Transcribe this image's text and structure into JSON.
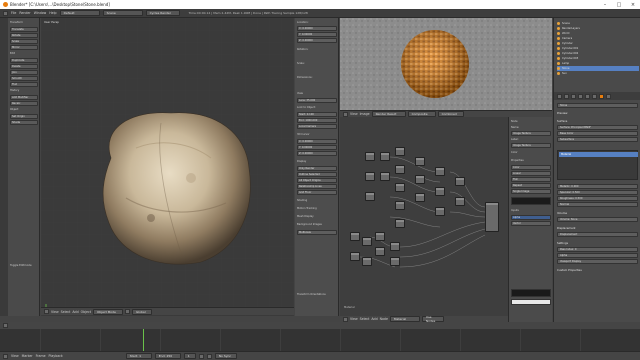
{
  "window": {
    "title": "Blender* [C:\\Users\\...\\Desktop\\Stone\\Stone.blend]",
    "controls": [
      "–",
      "□",
      "×"
    ]
  },
  "topbar": {
    "menus": [
      "File",
      "Render",
      "Window",
      "Help"
    ],
    "layout": "Default",
    "scene": "Scene",
    "engine": "Cycles Render",
    "stats": "Time:00:00.14 | Mem:1.42M, Peak 1.90M | Done | Path Tracing Sample 128/128"
  },
  "left_panel": {
    "sections": [
      "Transform",
      "Edit",
      "History",
      "Object"
    ],
    "buttons": [
      "Translate",
      "Rotate",
      "Scale",
      "Mirror",
      "Duplicate",
      "Delete",
      "Join",
      "Smooth",
      "Flat",
      "Add Modifier",
      "Recalc",
      "Set Origin",
      "Shade",
      "Remove",
      "Data",
      "Mode"
    ],
    "operator_title": "Toggle Editmode"
  },
  "viewport": {
    "header": "User Persp",
    "object_label": "(1) Stone",
    "menus": [
      "View",
      "Select",
      "Add",
      "Object"
    ],
    "mode": "Object Mode",
    "shading": "Global"
  },
  "n_panel": {
    "labels": [
      "Location:",
      "Rotation:",
      "Scale:",
      "Dimensions:",
      "View",
      "Lens:",
      "Lock to Object:",
      "Clip:",
      "3D Cursor",
      "Display",
      "Shading",
      "Motion Tracking",
      "Mesh Display",
      "Background Images",
      "Transform Orientations"
    ],
    "fields": [
      "X: 0.00000",
      "Y: 0.00000",
      "Z: 0.00000",
      "Lens: 35.000",
      "Start: 0.100",
      "End: 1000.000",
      "Local Camera",
      "X: 0.00000",
      "Y: 0.00000",
      "Z: 0.00000",
      "Only Render",
      "Outline Selected",
      "All Object Origins",
      "Relationship Lines",
      "Grid Floor",
      "Multiview"
    ]
  },
  "render_header": {
    "menus": [
      "View",
      "Image"
    ],
    "slot": "Render Result",
    "layer": "Composite",
    "pass": "Combined"
  },
  "node_editor": {
    "label": "Material",
    "menus": [
      "View",
      "Select",
      "Add",
      "Node"
    ],
    "material": "Material",
    "use_nodes": "Use Nodes"
  },
  "node_props": {
    "sections": [
      "Node",
      "Name:",
      "Label:",
      "Color",
      "Properties",
      "Inputs"
    ],
    "fields": [
      "Image Texture",
      "Image Texture",
      "Color",
      "Linear",
      "Flat",
      "Repeat",
      "Single Image",
      "Alpha",
      "Vector"
    ]
  },
  "outliner": {
    "items": [
      "Scene",
      "RenderLayers",
      "World",
      "Camera",
      "Cylinder",
      "Cylinder.001",
      "Cylinder.002",
      "Cylinder.003",
      "Lamp",
      "Stone",
      "Sun"
    ]
  },
  "properties": {
    "tabs": [
      "Render",
      "Layers",
      "Scene",
      "World",
      "Object",
      "Modifiers",
      "Material",
      "Texture"
    ],
    "sections": [
      "Stone",
      "Preview",
      "Surface",
      "Volume",
      "Displacement",
      "Settings",
      "Custom Properties"
    ],
    "fields": [
      "Material",
      "Surface: Principled BSDF",
      "Base Color",
      "Subsurface",
      "Metallic: 0.000",
      "Specular: 0.500",
      "Roughness: 0.500",
      "Normal",
      "Volume: None",
      "Displacement",
      "Pass Index: 0",
      "Alpha",
      "Viewport Display"
    ]
  },
  "timeline": {
    "menus": [
      "View",
      "Marker",
      "Frame",
      "Playback"
    ],
    "start": "Start: 1",
    "end": "End: 250",
    "current": "1",
    "sync": "No Sync"
  },
  "colors": {
    "accent": "#e87d0d",
    "panel": "#4a4a4a",
    "header": "#3d3d3d",
    "selection": "#5680c2"
  }
}
